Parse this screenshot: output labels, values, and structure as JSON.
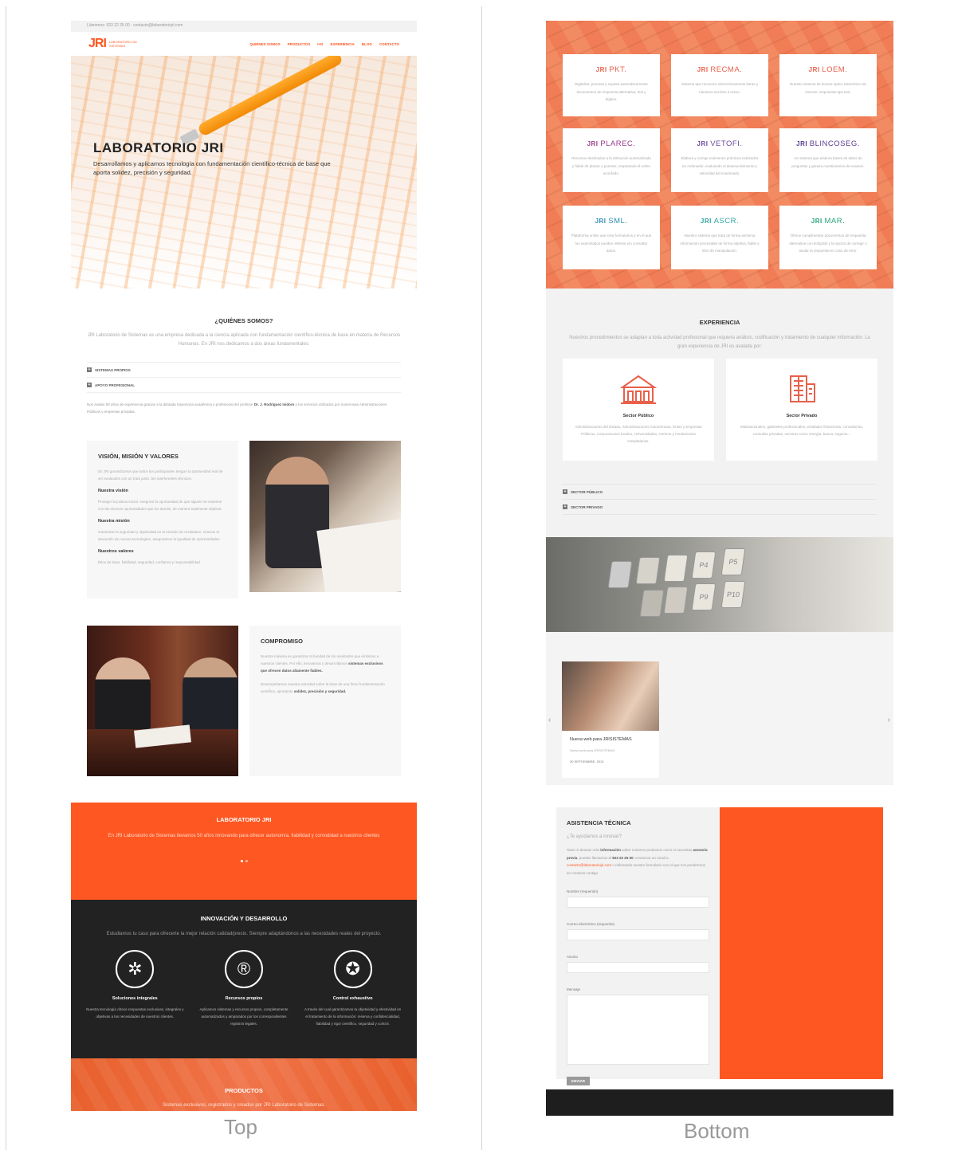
{
  "captions": {
    "left": "Top",
    "right": "Bottom"
  },
  "colors": {
    "accent": "#ff5722",
    "dark": "#222222",
    "light_bg": "#f2f2f2"
  },
  "topbar": {
    "text": "Llámenos: 923 22 25 00 · contacto@laboratoriojri.com"
  },
  "logo": {
    "mark": "JRI",
    "text": "LABORATORIO DE SISTEMAS"
  },
  "nav": {
    "items": [
      "QUIÉNES SOMOS",
      "PRODUCTOS",
      "I+D",
      "EXPERIENCIA",
      "BLOG",
      "CONTACTO"
    ]
  },
  "hero": {
    "title": "LABORATORIO JRI",
    "subtitle": "Desarrollamos y aplicamos tecnología con fundamentación científico-técnica de base que aporta solidez, precisión y seguridad."
  },
  "about": {
    "title": "¿QUIÉNES SOMOS?",
    "text": "JRI Laboratorio de Sistemas es una empresa dedicada a la ciencia aplicada con fundamentación científico-técnica de base en materia de Recursos Humanos. En JRI nos dedicamos a dos áreas fundamentales:",
    "accordion": [
      "SISTEMAS PROPIOS",
      "APOYO PROFESIONAL"
    ],
    "footnote_a": "Nos avalan 50 años de experiencia gracias a la dilatada trayectoria académica y profesional del profesor ",
    "footnote_bold": "Dr. J. Rodríguez Isidoro",
    "footnote_b": " y los servicios utilizados por numerosas Administraciones Públicas y empresas privadas."
  },
  "vision": {
    "title": "VISIÓN, MISIÓN Y VALORES",
    "intro": "En JRI garantizamos que todos los participantes tengan la oportunidad real de ser evaluados con un trato justo. Sin interferentes técnicos.",
    "h_vision": "Nuestra visión",
    "p_vision": "Proteger la justicia social. Asegurar la oportunidad de que alguien se examine con las mismas oportunidades que los demás, de manera totalmente objetiva.",
    "h_mision": "Nuestra misión",
    "p_mision": "Garantizar la seguridad y objetividad en la emisión de resultados. Gracias al desarrollo de nuevas tecnologías, aseguramos la igualdad de oportunidades.",
    "h_valores": "Nuestros valores",
    "p_valores": "Ética de base, fiabilidad, seguridad, confianza y responsabilidad."
  },
  "compromiso": {
    "title": "COMPROMISO",
    "p1a": "Nuestra máxima es garantizar la bondad de los resultados que emitimos a nuestros clientes. Por ello, innovamos y desarrollamos ",
    "p1b": "sistemas exclusivos que ofrecen datos altamente fiables.",
    "p2a": "Desempeñamos nuestra actividad sobre la base de una firme fundamentación científica, aportando ",
    "p2b": "solidez, precisión y seguridad."
  },
  "lab_band": {
    "title": "LABORATORIO JRI",
    "text": "En JRI Laboratorio de Sistemas llevamos 50 años innovando para ofrecer autonomía, fiabilidad y comodidad a nuestros clientes"
  },
  "rd": {
    "title": "INNOVACIÓN Y DESARROLLO",
    "text": "Estudiamos tu caso para ofrecerte la mejor relación calidad/precio. Siempre adaptándonos a las necesidades reales del proyecto.",
    "items": [
      {
        "icon": "network-icon",
        "glyph": "✲",
        "title": "Soluciones integrales",
        "text": "Nuestra tecnología ofrece respuestas exclusivas, integrales y objetivas a las necesidades de nuestros clientes."
      },
      {
        "icon": "registered-gear-icon",
        "glyph": "®",
        "title": "Recursos propios",
        "text": "Aplicamos sistemas y recursos propios, completamente automatizados y amparados por los correspondientes registros legales."
      },
      {
        "icon": "award-ribbon-icon",
        "glyph": "✪",
        "title": "Control exhaustivo",
        "text": "A través del cual garantizamos la objetividad y efectividad en el tratamiento de la información: reserva y confidencialidad, fiabilidad y rigor científico, seguridad y control."
      }
    ]
  },
  "productos": {
    "title": "PRODUCTOS",
    "text": "Sistemas exclusivos, registrados y creados por JRI Laboratorio de Sistemas."
  },
  "products": [
    {
      "name": "PKT.",
      "color": "#e8604a",
      "text": "Digitaliza, procesa y explota automáticamente documentos de respuesta alternativa, test y dígitos."
    },
    {
      "name": "RECMA.",
      "color": "#e8604a",
      "text": "Sistema que reconoce electrónicamente letras y números escritos a mano."
    },
    {
      "name": "LOEM.",
      "color": "#e8604a",
      "text": "Nuestro sistema de lectura óptico electrónico de marcas: respuestas tipo test."
    },
    {
      "name": "PLAREC.",
      "color": "#9b3b8f",
      "text": "Recursos destinados a la atribución automatizada y fiable de plazas o puestos, respetando el orden acordado."
    },
    {
      "name": "VETOFI.",
      "color": "#6b4a9b",
      "text": "Elabora y corrige exámenes prácticos realizados en ordenador, evaluando el desenvolvimiento y velocidad del examinado."
    },
    {
      "name": "BLINCOSEG.",
      "color": "#5a3b8f",
      "text": "Un sistema que elabora bases de datos de preguntas y genera cuestionarios de examen."
    },
    {
      "name": "SML.",
      "color": "#2f8fb3",
      "text": "Plataforma online que crea formularios y en el que los examinados pueden rellenar y/o consultar datos."
    },
    {
      "name": "ASCR.",
      "color": "#2aa3a0",
      "text": "Nuestro sistema que trata de forma anónima información procesable de forma objetiva, fiable y libre de manipulación."
    },
    {
      "name": "MAR.",
      "color": "#2aa37a",
      "text": "Ofrece cumplimentar documentos de respuesta alternativa con bolígrafo y la opción de corregir o anular la respuesta en caso de error."
    }
  ],
  "experiencia": {
    "title": "EXPERIENCIA",
    "text": "Nuestros procedimientos se adaptan a toda actividad profesional que requiera análisis, codificación y tratamiento de cualquier información. La gran experiencia de JRI es avalada por:",
    "sectors": [
      {
        "icon": "public-building-icon",
        "title": "Sector Público",
        "text": "Administraciones del Estado, Administraciones Autonómicas, Entes y Empresas Públicas, Corporaciones locales, Universidades, Centros y Fundaciones Hospitalarias."
      },
      {
        "icon": "office-building-icon",
        "title": "Sector Privado",
        "text": "Multinacionales, gabinetes profesionales, entidades financieras, consultorías, consultas privadas, sectores como energía, banca, seguros..."
      }
    ],
    "accordion": [
      "SECTOR PÚBLICO",
      "SECTOR PRIVADO"
    ]
  },
  "keys": [
    "P4",
    "P5",
    "P9",
    "P10"
  ],
  "blog": {
    "post_title": "Nueva web para JRISISTEMAS",
    "post_excerpt": "Nueva web para JRISISTEMAS",
    "post_date": "30 SEPTIEMBRE, 2013",
    "prev": "‹",
    "next": "›"
  },
  "contact": {
    "title": "ASISTENCIA TÉCNICA",
    "subtitle": "¿Te ayudamos a innovar?",
    "p_a": "Tanto si deseas más ",
    "p_b": "información",
    "p_c": " sobre nuestros productos como si necesitas ",
    "p_d": "asesoría previa",
    "p_e": ", puedes llamarnos al ",
    "p_f": "923 22 25 00",
    "p_g": ", enviarnos un email a ",
    "p_h": "contacto@laboratoriojri.com",
    "p_i": " o rellenando nuestro formulario con el que nos pondremos en contacto contigo.",
    "label_name": "Nombre (requerido)",
    "label_email": "Correo electrónico (requerido)",
    "label_subject": "Asunto",
    "label_message": "Mensaje",
    "submit": "ENVIAR"
  }
}
